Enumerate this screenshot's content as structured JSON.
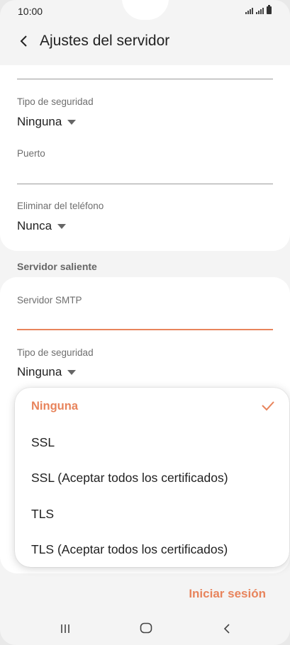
{
  "status_bar": {
    "time": "10:00"
  },
  "header": {
    "title": "Ajustes del servidor"
  },
  "incoming": {
    "security_label": "Tipo de seguridad",
    "security_value": "Ninguna",
    "port_label": "Puerto",
    "port_value": "",
    "delete_label": "Eliminar del teléfono",
    "delete_value": "Nunca"
  },
  "outgoing": {
    "section_title": "Servidor saliente",
    "smtp_label": "Servidor SMTP",
    "smtp_value": "",
    "security_label": "Tipo de seguridad",
    "security_value": "Ninguna"
  },
  "dropdown": {
    "options": [
      {
        "label": "Ninguna",
        "selected": true
      },
      {
        "label": "SSL",
        "selected": false
      },
      {
        "label": "SSL (Aceptar todos los certificados)",
        "selected": false
      },
      {
        "label": "TLS",
        "selected": false
      },
      {
        "label": "TLS (Aceptar todos los certificados)",
        "selected": false
      }
    ]
  },
  "footer": {
    "signin_label": "Iniciar sesión"
  },
  "colors": {
    "accent": "#e8845c",
    "background": "#f4f4f4",
    "card": "#ffffff"
  },
  "icons": [
    "back-arrow-icon",
    "caret-down-icon",
    "check-icon",
    "recent-apps-icon",
    "home-icon",
    "nav-back-icon",
    "signal-icon",
    "battery-icon"
  ]
}
